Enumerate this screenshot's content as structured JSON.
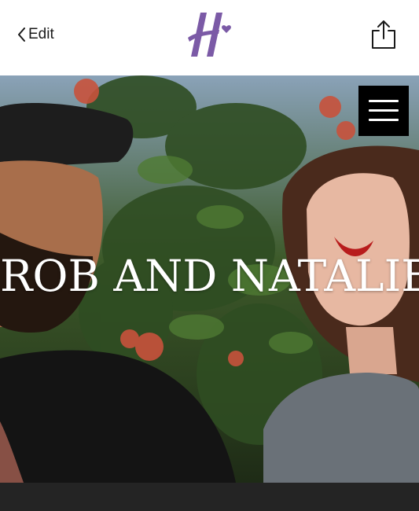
{
  "nav": {
    "back_label": "Edit",
    "back_icon": "chevron-left-icon",
    "logo_icon": "h-heart-logo",
    "share_icon": "share-icon"
  },
  "hero": {
    "title": "ROB AND NATALIE",
    "menu_icon": "hamburger-icon"
  },
  "colors": {
    "brand": "#7b5aa6",
    "menu_bg": "#000000",
    "footer_bg": "#242424"
  }
}
